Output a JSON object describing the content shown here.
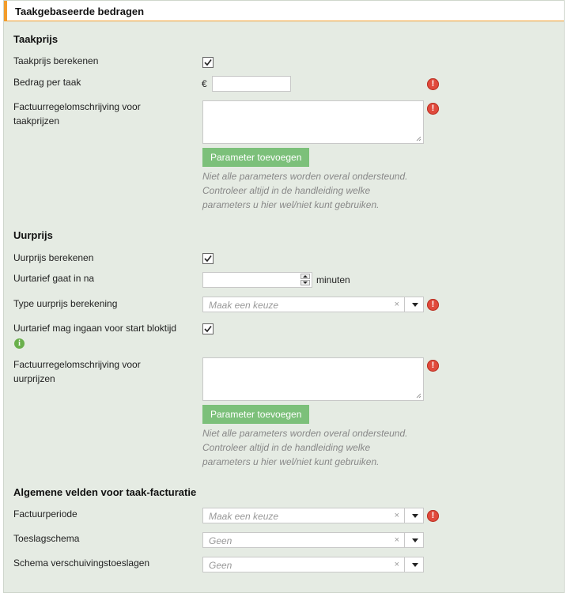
{
  "header": {
    "title": "Taakgebaseerde bedragen"
  },
  "taakprijs": {
    "section_title": "Taakprijs",
    "calc_label": "Taakprijs berekenen",
    "amount_label": "Bedrag per taak",
    "currency": "€",
    "amount_value": "",
    "desc_label_line1": "Factuurregelomschrijving voor",
    "desc_label_line2": "taakprijzen",
    "desc_value": "",
    "param_button": "Parameter toevoegen",
    "note_line1": "Niet alle parameters worden overal ondersteund.",
    "note_line2": "Controleer altijd in de handleiding welke",
    "note_line3": "parameters u hier wel/niet kunt gebruiken."
  },
  "uurprijs": {
    "section_title": "Uurprijs",
    "calc_label": "Uurprijs berekenen",
    "start_label": "Uurtarief gaat in na",
    "start_value": "",
    "start_unit": "minuten",
    "type_label": "Type uurprijs berekening",
    "type_placeholder": "Maak een keuze",
    "before_start_label": "Uurtarief mag ingaan voor start bloktijd",
    "desc_label_line1": "Factuurregelomschrijving voor",
    "desc_label_line2": "uurprijzen",
    "desc_value": "",
    "param_button": "Parameter toevoegen",
    "note_line1": "Niet alle parameters worden overal ondersteund.",
    "note_line2": "Controleer altijd in de handleiding welke",
    "note_line3": "parameters u hier wel/niet kunt gebruiken."
  },
  "algemeen": {
    "section_title": "Algemene velden voor taak-facturatie",
    "period_label": "Factuurperiode",
    "period_placeholder": "Maak een keuze",
    "surcharge_label": "Toeslagschema",
    "surcharge_value": "Geen",
    "shift_label": "Schema verschuivingstoeslagen",
    "shift_value": "Geen"
  },
  "icons": {
    "error": "error-icon",
    "info": "info-icon",
    "clear": "×",
    "checked": true
  },
  "colors": {
    "accent": "#f39c2b",
    "panel_bg": "#e5ebe3",
    "button_bg": "#7cc07a",
    "error": "#e04a3c",
    "info": "#6ab04c"
  }
}
